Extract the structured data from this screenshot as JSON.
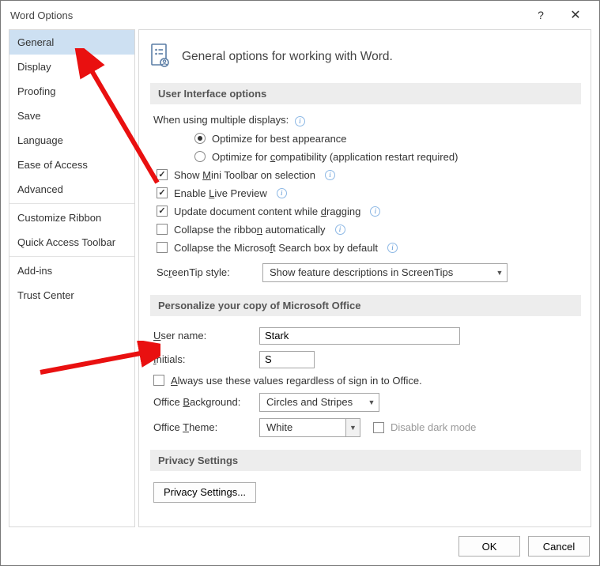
{
  "titlebar": {
    "title": "Word Options"
  },
  "sidebar": {
    "items": [
      {
        "label": "General",
        "selected": true
      },
      {
        "label": "Display"
      },
      {
        "label": "Proofing"
      },
      {
        "label": "Save"
      },
      {
        "label": "Language"
      },
      {
        "label": "Ease of Access"
      },
      {
        "label": "Advanced"
      }
    ],
    "items2": [
      {
        "label": "Customize Ribbon"
      },
      {
        "label": "Quick Access Toolbar"
      }
    ],
    "items3": [
      {
        "label": "Add-ins"
      },
      {
        "label": "Trust Center"
      }
    ]
  },
  "header": {
    "text": "General options for working with Word."
  },
  "ui_section": {
    "title": "User Interface options",
    "multi_displays_label": "When using multiple displays:",
    "radio_best": "Optimize for best appearance",
    "radio_compat": "Optimize for compatibility (application restart required)",
    "mini_toolbar": "Show Mini Toolbar on selection",
    "live_preview": "Enable Live Preview",
    "drag_update": "Update document content while dragging",
    "collapse_ribbon": "Collapse the ribbon automatically",
    "collapse_search": "Collapse the Microsoft Search box by default",
    "screentip_label": "ScreenTip style:",
    "screentip_value": "Show feature descriptions in ScreenTips"
  },
  "personalize": {
    "title": "Personalize your copy of Microsoft Office",
    "username_label": "User name:",
    "username_value": "Stark",
    "initials_label": "Initials:",
    "initials_value": "S",
    "always_use": "Always use these values regardless of sign in to Office.",
    "bg_label": "Office Background:",
    "bg_value": "Circles and Stripes",
    "theme_label": "Office Theme:",
    "theme_value": "White",
    "disable_dark": "Disable dark mode"
  },
  "privacy": {
    "title": "Privacy Settings",
    "button": "Privacy Settings..."
  },
  "footer": {
    "ok": "OK",
    "cancel": "Cancel"
  }
}
